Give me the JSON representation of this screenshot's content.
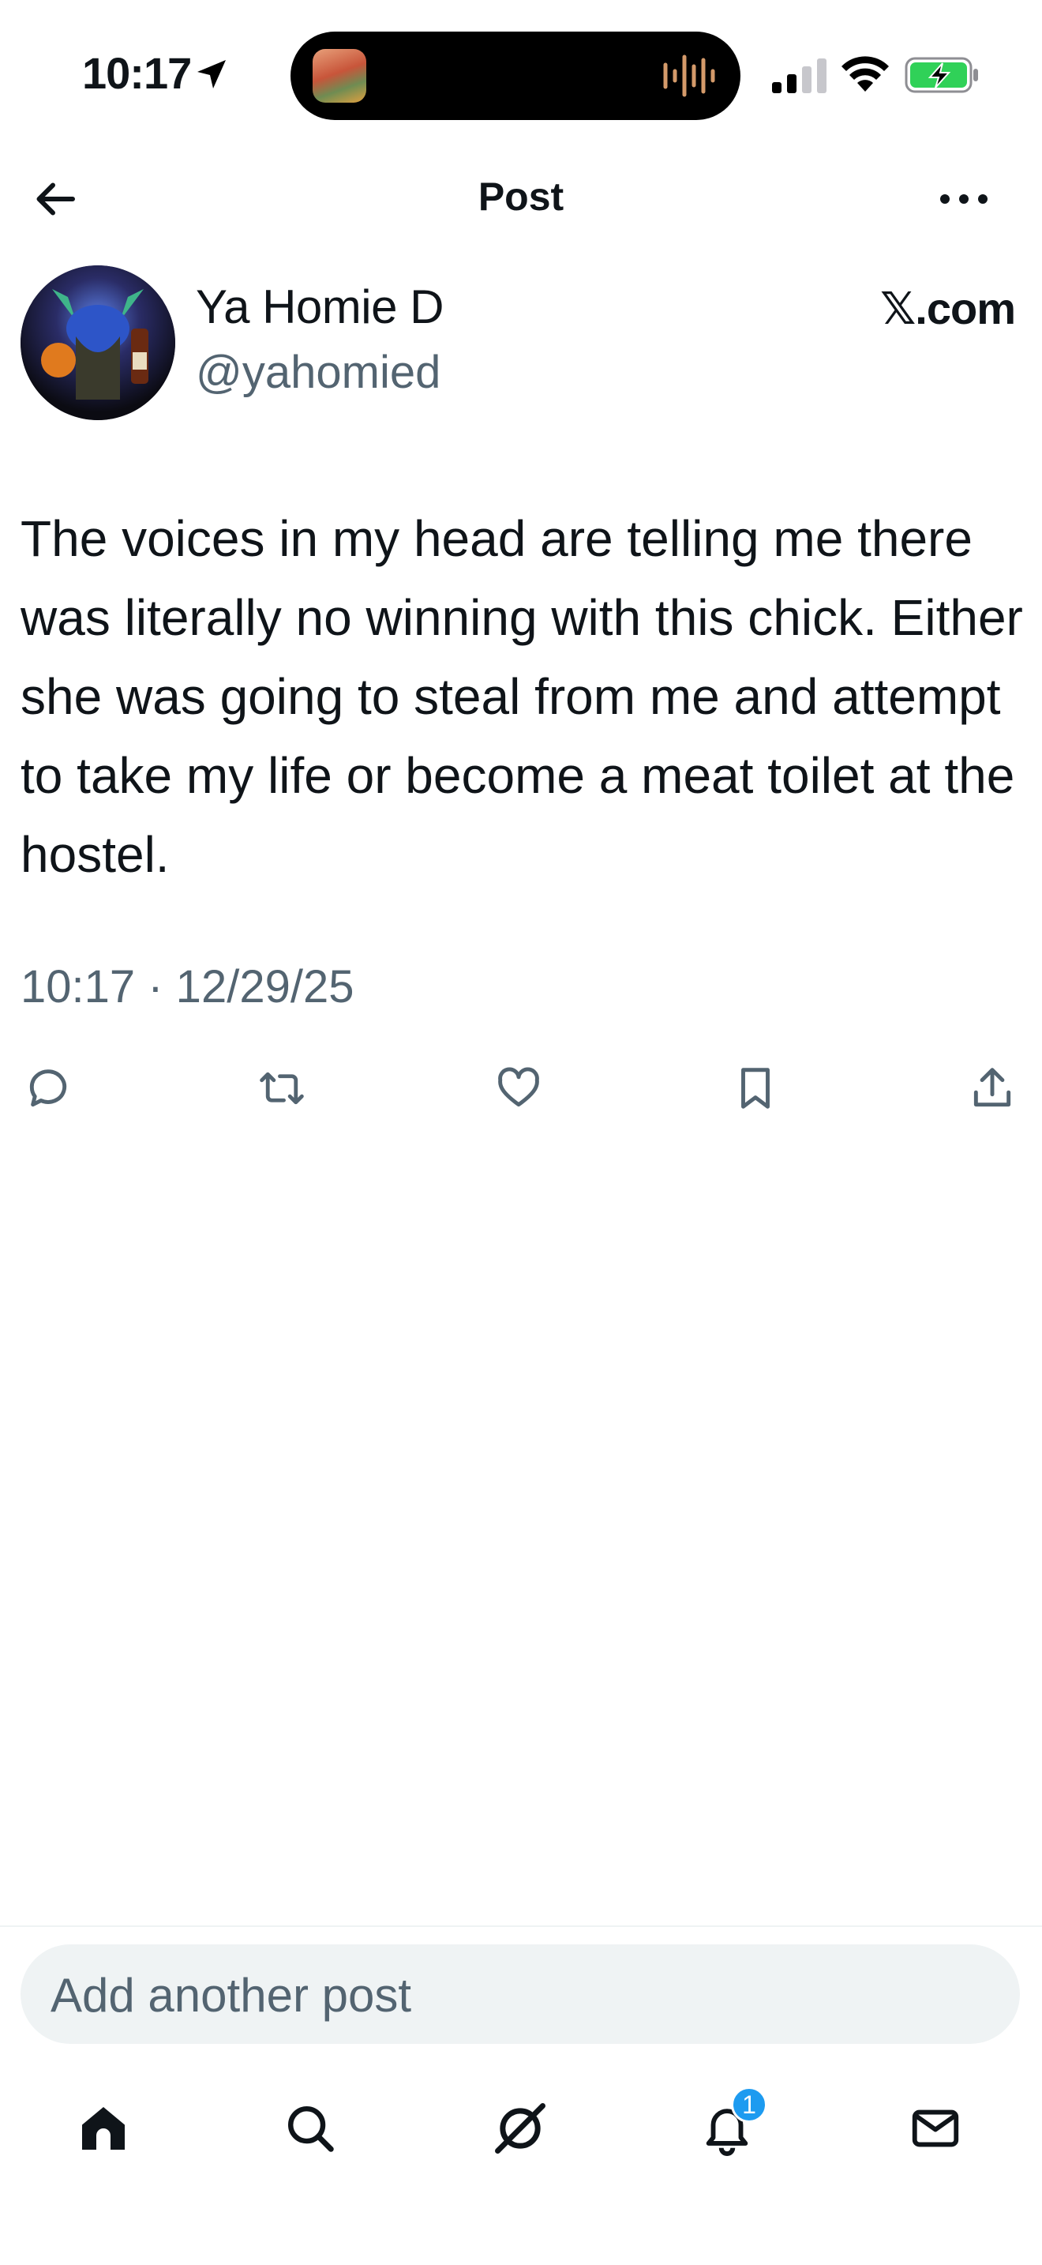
{
  "status_bar": {
    "time": "10:17",
    "battery_color": "#30d158"
  },
  "header": {
    "title": "Post",
    "back_icon": "arrow-left-icon",
    "more_icon": "more-horizontal-icon"
  },
  "author": {
    "name": "Ya Homie D",
    "handle": "@yahomied",
    "source_label": "𝕏.com"
  },
  "post": {
    "text": "The voices in my head are telling me there was literally no winning with this chick. Either she was going to steal from me and attempt to take my life or become a meat toilet at the hostel.",
    "timestamp": "10:17 · 12/29/25"
  },
  "actions": [
    {
      "name": "reply",
      "icon": "reply-icon"
    },
    {
      "name": "repost",
      "icon": "repost-icon"
    },
    {
      "name": "like",
      "icon": "heart-icon"
    },
    {
      "name": "bookmark",
      "icon": "bookmark-icon"
    },
    {
      "name": "share",
      "icon": "share-icon"
    }
  ],
  "compose": {
    "placeholder": "Add another post"
  },
  "nav": {
    "items": [
      "home",
      "search",
      "grok",
      "notifications",
      "messages"
    ],
    "notifications_badge": "1",
    "badge_color": "#1d9bf0"
  },
  "colors": {
    "text_primary": "#0f1419",
    "text_secondary": "#536471",
    "accent": "#1d9bf0"
  }
}
